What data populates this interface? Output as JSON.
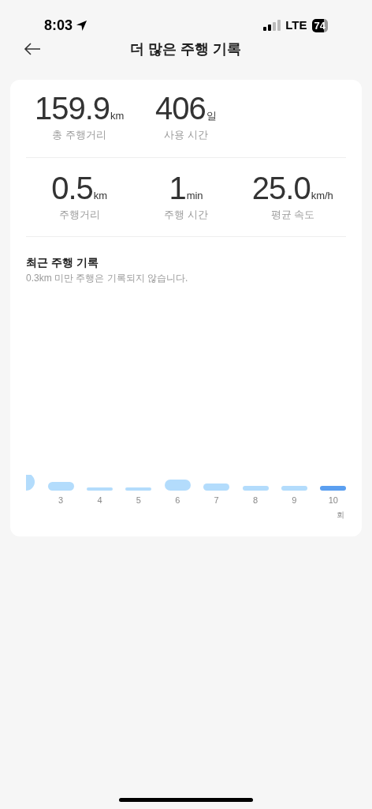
{
  "status_bar": {
    "time": "8:03",
    "network": "LTE",
    "battery": "74"
  },
  "header": {
    "title": "더 많은 주행 기록"
  },
  "summary": [
    {
      "value": "159.9",
      "unit": "km",
      "label": "총 주행거리"
    },
    {
      "value": "406",
      "unit": "일",
      "label": "사용 시간"
    }
  ],
  "last_ride": [
    {
      "value": "0.5",
      "unit": "km",
      "label": "주행거리"
    },
    {
      "value": "1",
      "unit": "min",
      "label": "주행 시간"
    },
    {
      "value": "25.0",
      "unit": "km/h",
      "label": "평균 속도"
    }
  ],
  "recent": {
    "title": "최근 주행 기록",
    "note": "0.3km 미만 주행은 기록되지 않습니다.",
    "unit": "회",
    "bars": [
      {
        "selected": false
      },
      {
        "label": "3",
        "selected": false
      },
      {
        "label": "4",
        "selected": false
      },
      {
        "label": "5",
        "selected": false
      },
      {
        "label": "6",
        "selected": false
      },
      {
        "label": "7",
        "selected": false
      },
      {
        "label": "8",
        "selected": false
      },
      {
        "label": "9",
        "selected": false
      },
      {
        "label": "10",
        "selected": true
      }
    ]
  }
}
